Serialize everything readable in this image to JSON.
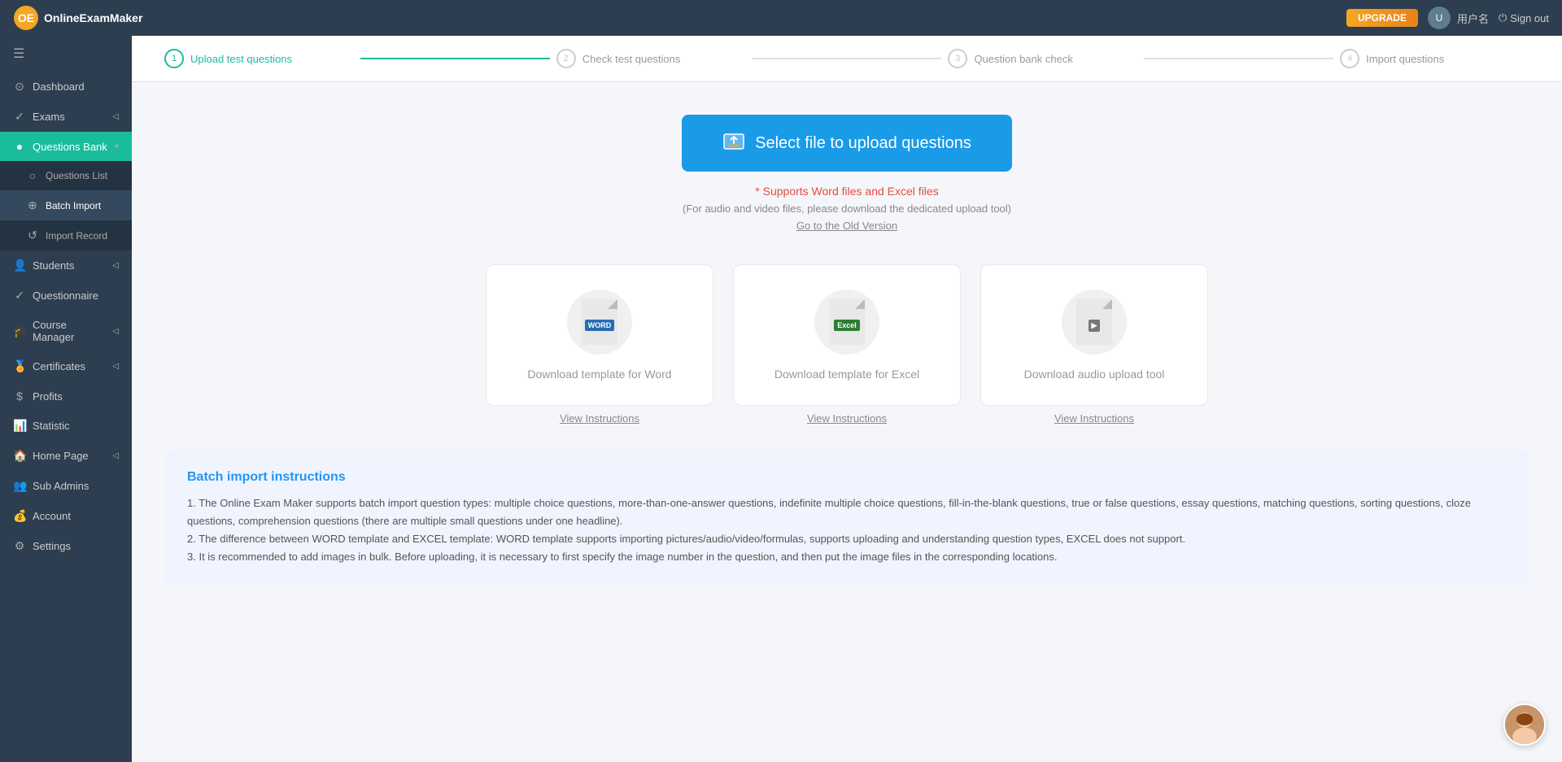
{
  "app": {
    "logo_text": "OnlineExamMaker"
  },
  "topbar": {
    "upgrade_label": "UPGRADE",
    "user_name": "用户名",
    "signout_label": "Sign out"
  },
  "sidebar": {
    "hamburger_icon": "☰",
    "items": [
      {
        "id": "dashboard",
        "label": "Dashboard",
        "icon": "⊙"
      },
      {
        "id": "exams",
        "label": "Exams",
        "icon": "✓",
        "has_arrow": true
      },
      {
        "id": "questions-bank",
        "label": "Questions Bank",
        "icon": "●",
        "active": true,
        "has_arrow": true
      },
      {
        "id": "questions-list",
        "label": "Questions List",
        "sub": true,
        "icon": "○"
      },
      {
        "id": "batch-import",
        "label": "Batch Import",
        "sub": true,
        "icon": "⊕",
        "active_sub": true
      },
      {
        "id": "import-record",
        "label": "Import Record",
        "sub": true,
        "icon": "↺"
      },
      {
        "id": "students",
        "label": "Students",
        "icon": "👤",
        "has_arrow": true
      },
      {
        "id": "questionnaire",
        "label": "Questionnaire",
        "icon": "✓"
      },
      {
        "id": "course-manager",
        "label": "Course Manager",
        "icon": "🎓",
        "has_arrow": true
      },
      {
        "id": "certificates",
        "label": "Certificates",
        "icon": "🏅",
        "has_arrow": true
      },
      {
        "id": "profits",
        "label": "Profits",
        "icon": "$"
      },
      {
        "id": "statistic",
        "label": "Statistic",
        "icon": "📊"
      },
      {
        "id": "home-page",
        "label": "Home Page",
        "icon": "🏠",
        "has_arrow": true
      },
      {
        "id": "sub-admins",
        "label": "Sub Admins",
        "icon": "👥"
      },
      {
        "id": "account",
        "label": "Account",
        "icon": "💰"
      },
      {
        "id": "settings",
        "label": "Settings",
        "icon": "⚙"
      }
    ]
  },
  "stepper": {
    "steps": [
      {
        "number": "1",
        "label": "Upload test questions",
        "active": true
      },
      {
        "number": "2",
        "label": "Check test questions",
        "active": false
      },
      {
        "number": "3",
        "label": "Question bank check",
        "active": false
      },
      {
        "number": "4",
        "label": "Import questions",
        "active": false
      }
    ]
  },
  "upload": {
    "button_label": "Select file to upload questions",
    "note": "* Supports Word files and Excel files",
    "sub_note": "(For audio and video files, please download the dedicated upload tool)",
    "old_version_label": "Go to the Old Version"
  },
  "download_cards": [
    {
      "id": "word",
      "label": "Download template for Word",
      "file_type": "WORD",
      "view_instructions": "View Instructions"
    },
    {
      "id": "excel",
      "label": "Download template for Excel",
      "file_type": "Excel",
      "view_instructions": "View Instructions"
    },
    {
      "id": "audio",
      "label": "Download audio upload tool",
      "file_type": "audio",
      "view_instructions": "View Instructions"
    }
  ],
  "instructions": {
    "title": "Batch import instructions",
    "lines": [
      "1. The Online Exam Maker supports batch import question types: multiple choice questions, more-than-one-answer questions, indefinite multiple choice questions, fill-in-the-blank questions, true or false questions, essay questions, matching questions, sorting questions, cloze questions, comprehension questions (there are multiple small questions under one headline).",
      "2. The difference between WORD template and EXCEL template: WORD template supports importing pictures/audio/video/formulas, supports uploading and understanding question types, EXCEL does not support.",
      "3. It is recommended to add images in bulk. Before uploading, it is necessary to first specify the image number in the question, and then put the image files in the corresponding locations."
    ]
  }
}
